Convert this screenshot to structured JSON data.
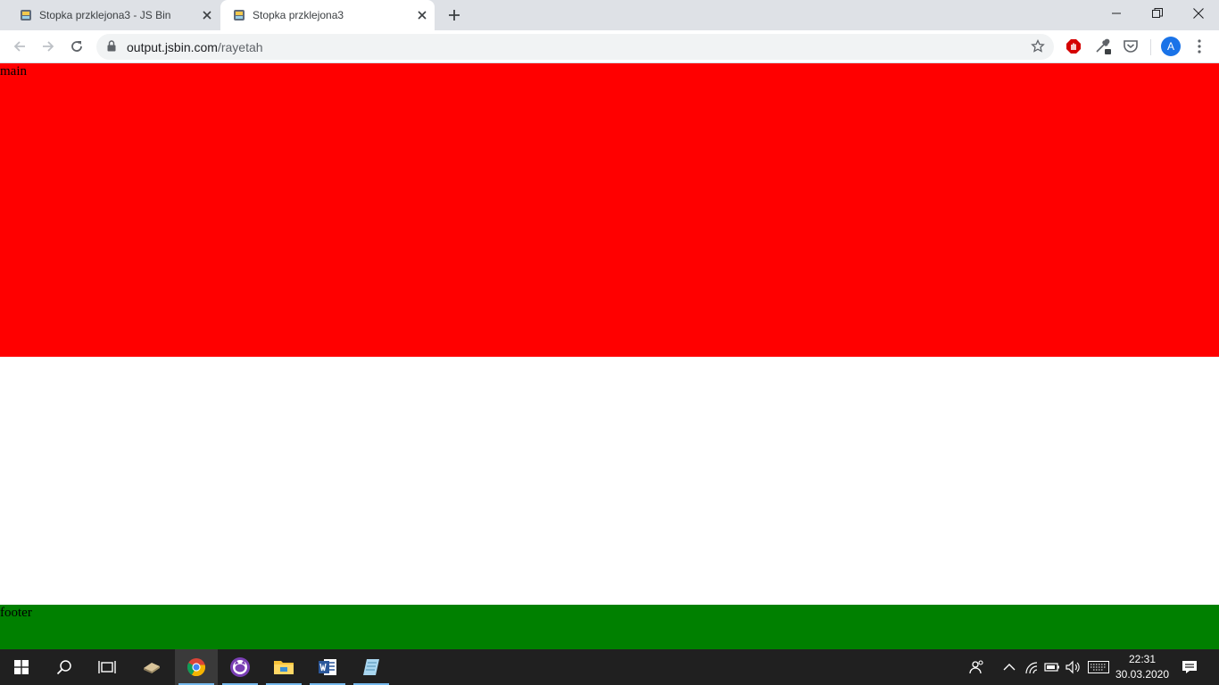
{
  "browser": {
    "tabs": [
      {
        "title": "Stopka przklejona3 - JS Bin",
        "active": false
      },
      {
        "title": "Stopka przklejona3",
        "active": true
      }
    ],
    "address": {
      "host": "output.jsbin.com",
      "path": "/rayetah"
    },
    "profile_initial": "A",
    "icons": {
      "back": "arrow-left-icon",
      "forward": "arrow-right-icon",
      "reload": "reload-icon",
      "lock": "lock-icon",
      "bookmark": "star-icon",
      "adblock": "stop-hand-icon",
      "eyedropper": "eyedropper-icon",
      "pocket": "pocket-icon",
      "menu": "kebab-menu-icon"
    }
  },
  "page": {
    "main_text": "main",
    "footer_text": "footer",
    "colors": {
      "main": "#ff0000",
      "footer": "#008000",
      "body": "#ffffff"
    }
  },
  "taskbar": {
    "apps": [
      "start",
      "search",
      "task-view",
      "app-explorer-legacy",
      "chrome",
      "cat-app",
      "file-explorer",
      "word",
      "notepad"
    ],
    "clock": {
      "time": "22:31",
      "date": "30.03.2020"
    }
  }
}
